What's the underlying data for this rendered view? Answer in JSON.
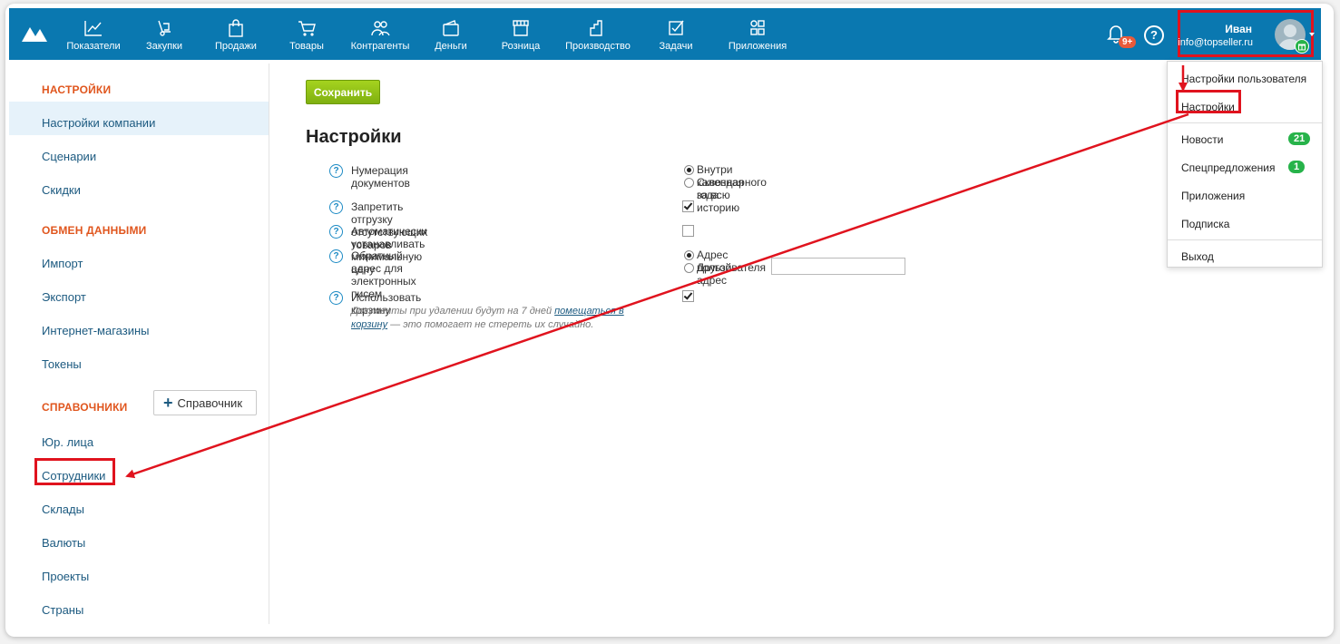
{
  "nav": {
    "items": [
      {
        "label": "Показатели",
        "icon": "chart-icon"
      },
      {
        "label": "Закупки",
        "icon": "hand-truck-icon"
      },
      {
        "label": "Продажи",
        "icon": "shopping-bag-icon"
      },
      {
        "label": "Товары",
        "icon": "cart-icon"
      },
      {
        "label": "Контрагенты",
        "icon": "people-icon"
      },
      {
        "label": "Деньги",
        "icon": "wallet-icon"
      },
      {
        "label": "Розница",
        "icon": "storefront-icon"
      },
      {
        "label": "Производство",
        "icon": "factory-icon"
      },
      {
        "label": "Задачи",
        "icon": "checkbox-icon"
      },
      {
        "label": "Приложения",
        "icon": "apps-icon"
      }
    ],
    "notifications_badge": "9+",
    "help_label": "?"
  },
  "user": {
    "name": "Иван",
    "email": "info@topseller.ru"
  },
  "sidebar": {
    "settings_header": "НАСТРОЙКИ",
    "company_settings": "Настройки компании",
    "scenarios": "Сценарии",
    "discounts": "Скидки",
    "exchange_header": "ОБМЕН ДАННЫМИ",
    "import": "Импорт",
    "export": "Экспорт",
    "online_stores": "Интернет-магазины",
    "tokens": "Токены",
    "directories_header": "СПРАВОЧНИКИ",
    "add_directory": "Справочник",
    "legal_entities": "Юр. лица",
    "employees": "Сотрудники",
    "warehouses": "Склады",
    "currencies": "Валюты",
    "projects": "Проекты",
    "countries": "Страны"
  },
  "main": {
    "save_label": "Сохранить",
    "title": "Настройки",
    "doc_numbering": "Нумерация документов",
    "within_year": "Внутри календарного года",
    "through_history": "Сквозная за всю историю",
    "forbid_shipment": "Запретить отгрузку отсутствующих товаров",
    "auto_min_price": "Автоматически устанавливать минимальную цену",
    "return_address": "Обратный адрес для электронных писем",
    "user_address": "Адрес пользователя",
    "other_address": "Другой адрес",
    "use_trash": "Использовать корзину",
    "hint_part1": "Документы при удалении будут на 7 дней ",
    "hint_link": "помещаться в корзину",
    "hint_part2": " — это помогает не стереть их случайно."
  },
  "dropdown": {
    "user_settings": "Настройки пользователя",
    "settings": "Настройки",
    "news": "Новости",
    "news_count": "21",
    "special_offers": "Спецпредложения",
    "special_offers_count": "1",
    "apps": "Приложения",
    "subscription": "Подписка",
    "logout": "Выход"
  },
  "colors": {
    "brand": "#0a78b0",
    "accent": "#e0561e",
    "highlight": "#e0131e",
    "save": "#8cc016",
    "badge": "#27b34a"
  }
}
